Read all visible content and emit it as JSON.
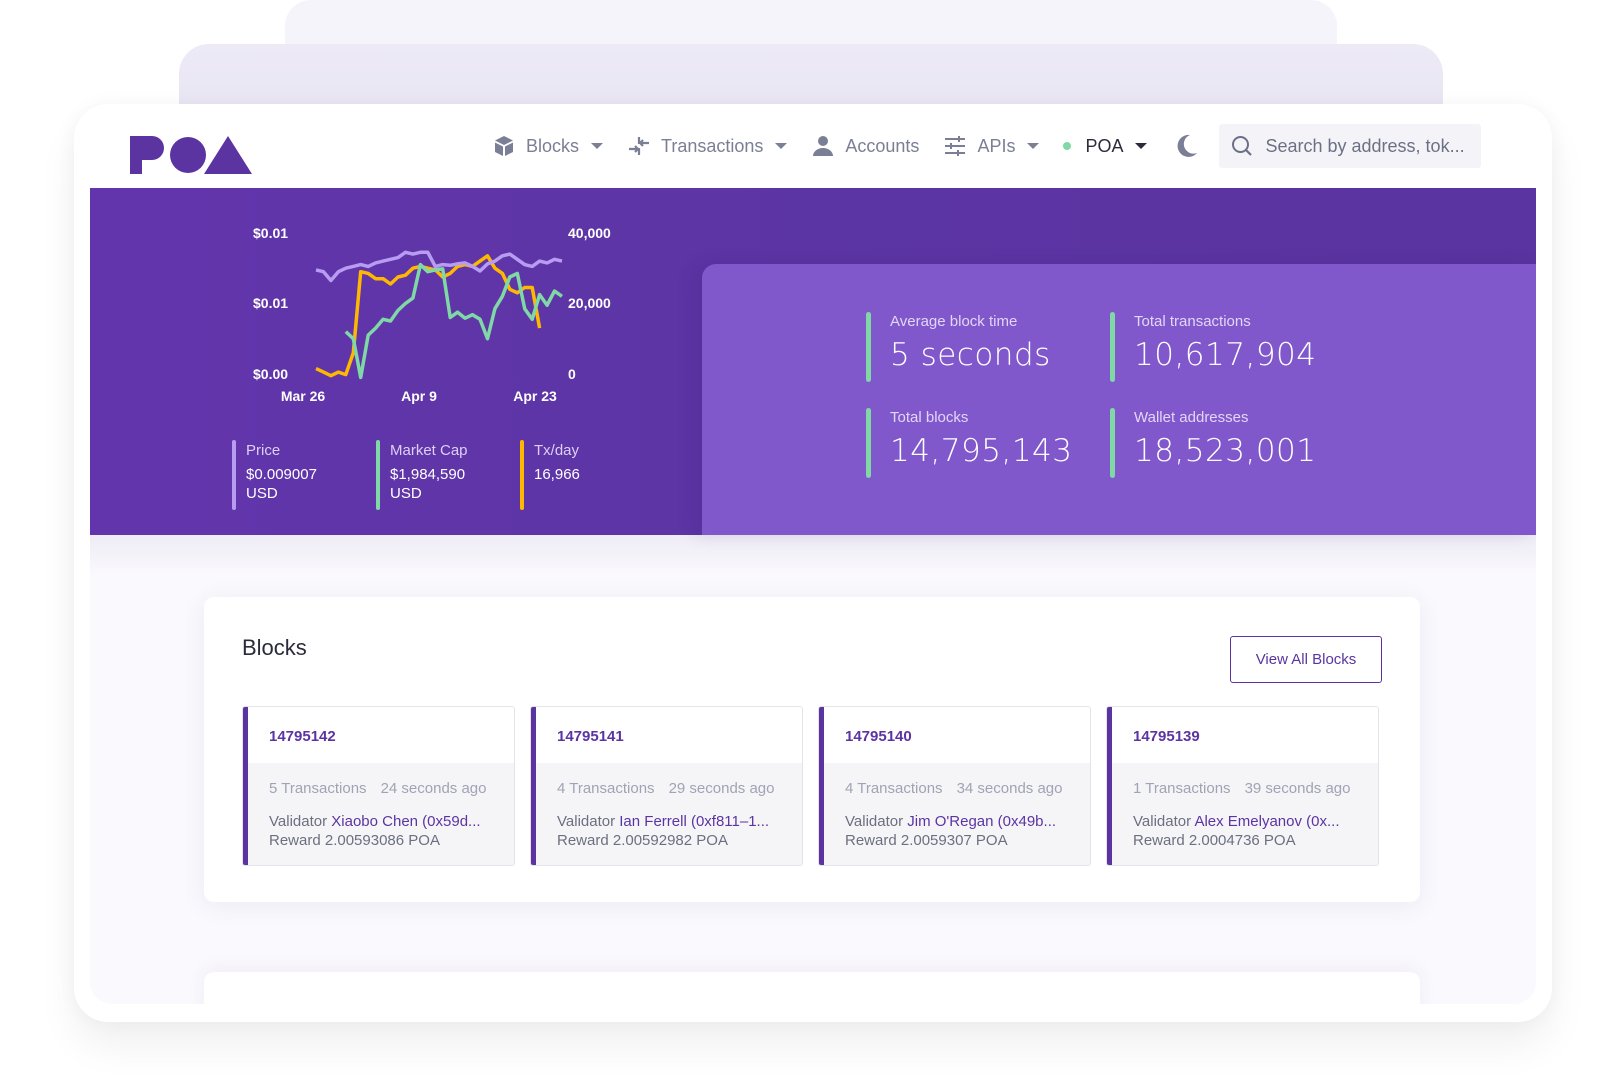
{
  "brand": {
    "name": "POA",
    "color": "#5c34a2"
  },
  "navbar": {
    "items": [
      {
        "label": "Blocks",
        "icon": "cube-icon",
        "dropdown": true
      },
      {
        "label": "Transactions",
        "icon": "arrows-exchange-icon",
        "dropdown": true
      },
      {
        "label": "Accounts",
        "icon": "user-icon",
        "dropdown": false
      },
      {
        "label": "APIs",
        "icon": "sliders-icon",
        "dropdown": true
      }
    ],
    "network": {
      "label": "POA",
      "status_color": "#7fd8a5"
    },
    "theme_toggle": "moon-icon",
    "search": {
      "placeholder": "Search by address, tok...",
      "value": ""
    }
  },
  "hero": {
    "legend": [
      {
        "title": "Price",
        "value": "$0.009007",
        "unit": "USD",
        "color": "#b89cf2"
      },
      {
        "title": "Market Cap",
        "value": "$1,984,590",
        "unit": "USD",
        "color": "#7fd8a5"
      },
      {
        "title": "Tx/day",
        "value": "16,966",
        "unit": "",
        "color": "#ffb800"
      }
    ],
    "stats": [
      {
        "label": "Average block time",
        "value": "5 seconds"
      },
      {
        "label": "Total transactions",
        "value": "10,617,904"
      },
      {
        "label": "Total blocks",
        "value": "14,795,143"
      },
      {
        "label": "Wallet addresses",
        "value": "18,523,001"
      }
    ]
  },
  "chart_data": {
    "type": "line",
    "title": "",
    "x_tick_labels": [
      "Mar 26",
      "Apr 9",
      "Apr 23"
    ],
    "y_left_tick_labels": [
      "$0.01",
      "$0.01",
      "$0.00"
    ],
    "y_right_tick_labels": [
      "40,000",
      "20,000",
      "0"
    ],
    "y_right_range": [
      0,
      40000
    ],
    "grid": false,
    "legend_position": "bottom",
    "series": [
      {
        "name": "Price",
        "axis": "left-normalized",
        "color": "#b89cf2",
        "values": [
          33500,
          33000,
          30500,
          33000,
          34000,
          34500,
          35000,
          34500,
          35500,
          36000,
          36500,
          37000,
          38500,
          38000,
          38500,
          38500,
          34500,
          35000,
          34800,
          35200,
          35500,
          34500,
          33200,
          35200,
          36000,
          37500,
          38000,
          36500,
          35000,
          34500,
          36000,
          35500,
          36500,
          36000
        ]
      },
      {
        "name": "Market Cap",
        "axis": "left-normalized",
        "color": "#7fd8a5",
        "values": [
          null,
          null,
          null,
          null,
          16000,
          14000,
          3000,
          15000,
          17000,
          19500,
          19000,
          22000,
          24000,
          25500,
          35000,
          33000,
          33500,
          33800,
          20000,
          21500,
          19800,
          20800,
          19500,
          14000,
          22500,
          26000,
          31500,
          32500,
          22500,
          19500,
          26500,
          23500,
          27500,
          26000
        ]
      },
      {
        "name": "Tx/day",
        "axis": "right",
        "color": "#ffb800",
        "values": [
          5500,
          4500,
          3500,
          4500,
          3800,
          10000,
          33000,
          32500,
          31000,
          31000,
          29500,
          31500,
          32000,
          34000,
          34500,
          34000,
          33500,
          31500,
          32500,
          34500,
          35000,
          34500,
          36000,
          37500,
          34000,
          32500,
          28000,
          27000,
          28500,
          28500,
          17000
        ]
      }
    ],
    "x_positions_note": "series are daily points spanning roughly Mar 22 to Apr 25"
  },
  "blocks_card": {
    "title": "Blocks",
    "view_all_label": "View All Blocks",
    "tiles": [
      {
        "number": "14795142",
        "tx_count": "5 Transactions",
        "age": "24 seconds ago",
        "validator_label": "Validator",
        "validator": "Xiaobo Chen (0x59d...",
        "reward": "Reward 2.00593086 POA"
      },
      {
        "number": "14795141",
        "tx_count": "4 Transactions",
        "age": "29 seconds ago",
        "validator_label": "Validator",
        "validator": "Ian Ferrell (0xf811–1...",
        "reward": "Reward 2.00592982 POA"
      },
      {
        "number": "14795140",
        "tx_count": "4 Transactions",
        "age": "34 seconds ago",
        "validator_label": "Validator",
        "validator": "Jim O'Regan (0x49b...",
        "reward": "Reward 2.0059307 POA"
      },
      {
        "number": "14795139",
        "tx_count": "1 Transactions",
        "age": "39 seconds ago",
        "validator_label": "Validator",
        "validator": "Alex Emelyanov (0x...",
        "reward": "Reward 2.0004736 POA"
      }
    ]
  }
}
